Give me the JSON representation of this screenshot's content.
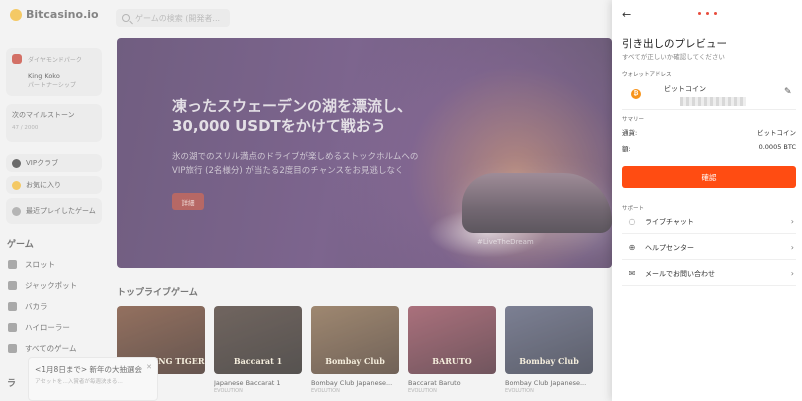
{
  "header": {
    "logo_text": "Bitcasino.io",
    "search_placeholder": "ゲームの検索 (開発者..."
  },
  "sidebar": {
    "user_status": "ダイヤモンドパーク",
    "user_name": "King Koko",
    "user_tier": "パートナーシップ",
    "milestone_title": "次のマイルストーン",
    "milestone_progress": "47 / 2000",
    "vip_label": "VIPクラブ",
    "favorites_label": "お気に入り",
    "recent_label": "最近プレイしたゲーム",
    "games_section": "ゲーム",
    "links": [
      "スロット",
      "ジャックポット",
      "バカラ",
      "ハイローラー",
      "すべてのゲーム"
    ],
    "partial_section": "ラ"
  },
  "banner": {
    "title": "凍ったスウェーデンの湖を漂流し、30,000 USDTをかけて戦おう",
    "description": "氷の湖でのスリル満点のドライブが楽しめるストックホルムへのVIP旅行 (2名様分) が当たる2度目のチャンスをお見逃しなく",
    "button": "詳細",
    "tag": "#LiveTheDream"
  },
  "top_live": {
    "title": "トップライブゲーム",
    "games": [
      {
        "name": "",
        "sub": "",
        "thumb": "LIGHTNING TIGER",
        "bg": "#3b1d14"
      },
      {
        "name": "Japanese Baccarat 1",
        "sub": "EVOLUTION",
        "thumb": "Baccarat 1",
        "bg": "#2a1f1a"
      },
      {
        "name": "Bombay Club Japanese...",
        "sub": "EVOLUTION",
        "thumb": "Bombay Club",
        "bg": "#5a3b2a"
      },
      {
        "name": "Baccarat Baruto",
        "sub": "EVOLUTION",
        "thumb": "BARUTO",
        "bg": "#6a2b3b"
      },
      {
        "name": "Bombay Club Japanese...",
        "sub": "EVOLUTION",
        "thumb": "Bombay Club",
        "bg": "#3a3f5a"
      }
    ]
  },
  "toast": {
    "title": "<1月8日まで> 新年の大抽選会",
    "body": "アセットを…入賞者が毎週決まる…"
  },
  "drawer": {
    "title": "引き出しのプレビュー",
    "subtitle": "すべてが正しいか確認してください",
    "wallet_label": "ウォレットアドレス",
    "wallet_name": "ビットコイン",
    "summary_label": "サマリー",
    "currency_label": "通貨:",
    "currency_value": "ビットコイン",
    "amount_label": "額:",
    "amount_value": "0.0005 BTC",
    "confirm_button": "確認",
    "support_label": "サポート",
    "support_items": [
      "ライブチャット",
      "ヘルプセンター",
      "メールでお問い合わせ"
    ],
    "accent_color": "#ff4c12"
  },
  "icons": {
    "back": "back-arrow-icon",
    "btc": "bitcoin-icon",
    "edit": "pencil-icon",
    "chat": "chat-icon",
    "help": "help-center-icon",
    "mail": "mail-icon"
  }
}
